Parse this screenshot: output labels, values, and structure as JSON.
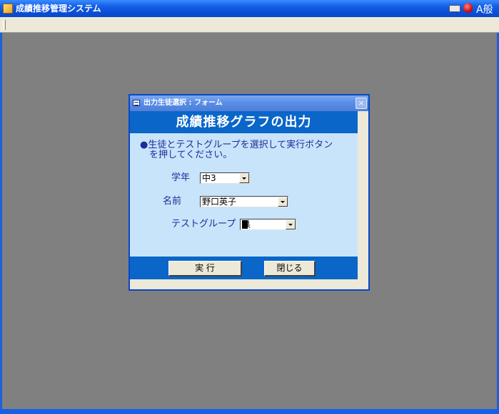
{
  "app": {
    "title": "成績推移管理システム",
    "ime_mode": "A般"
  },
  "dialog": {
    "title": "出力生徒選択 : フォーム",
    "close_label": "×",
    "header": "成績推移グラフの出力",
    "instruction_bullet": "●",
    "instruction_line1": "生徒とテストグループを選択して実行ボタン",
    "instruction_line2": "を押してください。",
    "fields": {
      "grade": {
        "label": "学年",
        "value": "中3"
      },
      "name": {
        "label": "名前",
        "value": "野口英子"
      },
      "test_group": {
        "label": "テストグループ",
        "value": "県"
      }
    },
    "buttons": {
      "run": "実 行",
      "close": "閉じる"
    }
  },
  "colors": {
    "titlebar": "#1660e8",
    "header_band": "#0a66c8",
    "content_bg": "#c8e4fa",
    "label_text": "#1c2c9c",
    "desktop": "#808080"
  }
}
